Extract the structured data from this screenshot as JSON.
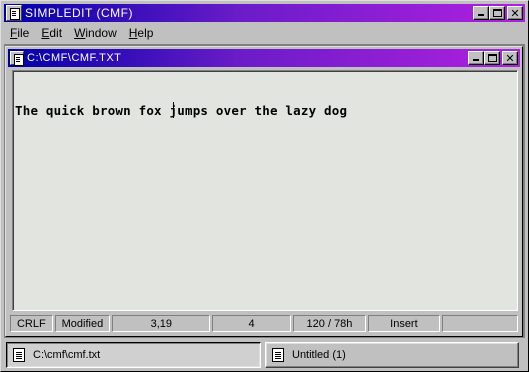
{
  "app": {
    "title": "SIMPLEDIT (CMF)"
  },
  "menu": {
    "items": [
      {
        "first": "F",
        "rest": "ile"
      },
      {
        "first": "E",
        "rest": "dit"
      },
      {
        "first": "W",
        "rest": "indow"
      },
      {
        "first": "H",
        "rest": "elp"
      }
    ]
  },
  "document": {
    "title": "C:\\CMF\\CMF.TXT",
    "content": "The quick brown fox jumps over the lazy dog"
  },
  "status": {
    "line_ending": "CRLF",
    "modified": "Modified",
    "position": "3,19",
    "column": "4",
    "char_info": "120 / 78h",
    "mode": "Insert",
    "extra": ""
  },
  "taskbar": {
    "items": [
      {
        "label": "C:\\cmf\\cmf.txt"
      },
      {
        "label": "Untitled (1)"
      }
    ]
  },
  "colors": {
    "titlebar_start": "#0000a8",
    "titlebar_end": "#b020e0",
    "editor_bg": "#e2e4df",
    "chrome": "#c0c0c0"
  }
}
